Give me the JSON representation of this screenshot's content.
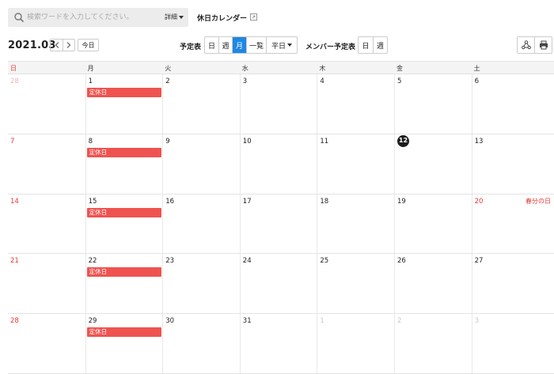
{
  "search": {
    "placeholder": "検索ワードを入力してください。",
    "detail_label": "詳細"
  },
  "calendar_title": "休日カレンダー",
  "toolbar": {
    "month": "2021.03",
    "today_label": "今日",
    "schedule_label": "予定表",
    "views": [
      "日",
      "週",
      "月",
      "一覧",
      "平日"
    ],
    "active_view": "月",
    "member_label": "メンバー予定表",
    "member_views": [
      "日",
      "週"
    ]
  },
  "weekdays": [
    "日",
    "月",
    "火",
    "水",
    "木",
    "金",
    "土"
  ],
  "weeks": [
    [
      {
        "d": "28",
        "other": true
      },
      {
        "d": "1",
        "event": "定休日"
      },
      {
        "d": "2"
      },
      {
        "d": "3"
      },
      {
        "d": "4"
      },
      {
        "d": "5"
      },
      {
        "d": "6"
      }
    ],
    [
      {
        "d": "7"
      },
      {
        "d": "8",
        "event": "定休日"
      },
      {
        "d": "9"
      },
      {
        "d": "10"
      },
      {
        "d": "11"
      },
      {
        "d": "12",
        "today": true
      },
      {
        "d": "13"
      }
    ],
    [
      {
        "d": "14"
      },
      {
        "d": "15",
        "event": "定休日"
      },
      {
        "d": "16"
      },
      {
        "d": "17"
      },
      {
        "d": "18"
      },
      {
        "d": "19"
      },
      {
        "d": "20",
        "holiday": "春分の日"
      }
    ],
    [
      {
        "d": "21"
      },
      {
        "d": "22",
        "event": "定休日"
      },
      {
        "d": "23"
      },
      {
        "d": "24"
      },
      {
        "d": "25"
      },
      {
        "d": "26"
      },
      {
        "d": "27"
      }
    ],
    [
      {
        "d": "28"
      },
      {
        "d": "29",
        "event": "定休日"
      },
      {
        "d": "30"
      },
      {
        "d": "31"
      },
      {
        "d": "1",
        "other": true
      },
      {
        "d": "2",
        "other": true
      },
      {
        "d": "3",
        "other": true
      }
    ]
  ],
  "colors": {
    "accent": "#1e88e5",
    "sunday": "#e53935",
    "event": "#ef5350",
    "today": "#1c1c1c"
  }
}
